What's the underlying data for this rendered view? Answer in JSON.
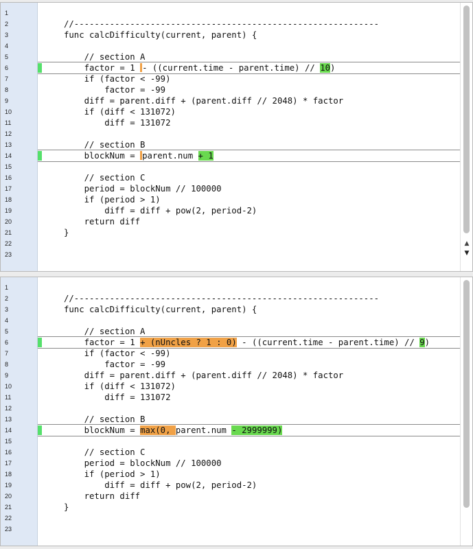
{
  "panes": [
    {
      "id": "before",
      "lines": [
        {
          "n": "1",
          "segs": []
        },
        {
          "n": "2",
          "segs": [
            {
              "t": "//------------------------------------------------------------"
            }
          ]
        },
        {
          "n": "3",
          "segs": [
            {
              "t": "func calcDifficulty(current, parent) {"
            }
          ]
        },
        {
          "n": "4",
          "segs": []
        },
        {
          "n": "5",
          "segs": [
            {
              "t": "    // section A"
            }
          ]
        },
        {
          "n": "6",
          "segs": [
            {
              "t": "    factor = 1 "
            },
            {
              "t": "",
              "h": "bar"
            },
            {
              "t": "- ((current.time - parent.time) // "
            },
            {
              "t": "10",
              "h": "green"
            },
            {
              "t": ")"
            }
          ],
          "marked": true
        },
        {
          "n": "7",
          "segs": [
            {
              "t": "    if (factor < -99)"
            }
          ]
        },
        {
          "n": "8",
          "segs": [
            {
              "t": "        factor = -99"
            }
          ]
        },
        {
          "n": "9",
          "segs": [
            {
              "t": "    diff = parent.diff + (parent.diff // 2048) * factor"
            }
          ]
        },
        {
          "n": "10",
          "segs": [
            {
              "t": "    if (diff < 131072)"
            }
          ]
        },
        {
          "n": "11",
          "segs": [
            {
              "t": "        diff = 131072"
            }
          ]
        },
        {
          "n": "12",
          "segs": []
        },
        {
          "n": "13",
          "segs": [
            {
              "t": "    // section B"
            }
          ]
        },
        {
          "n": "14",
          "segs": [
            {
              "t": "    blockNum = "
            },
            {
              "t": "",
              "h": "bar"
            },
            {
              "t": "parent.num "
            },
            {
              "t": "+ 1",
              "h": "green"
            }
          ],
          "marked": true
        },
        {
          "n": "15",
          "segs": []
        },
        {
          "n": "16",
          "segs": [
            {
              "t": "    // section C"
            }
          ]
        },
        {
          "n": "17",
          "segs": [
            {
              "t": "    period = blockNum // 100000"
            }
          ]
        },
        {
          "n": "18",
          "segs": [
            {
              "t": "    if (period > 1)"
            }
          ]
        },
        {
          "n": "19",
          "segs": [
            {
              "t": "        diff = diff + pow(2, period-2)"
            }
          ]
        },
        {
          "n": "20",
          "segs": [
            {
              "t": "    return diff"
            }
          ]
        },
        {
          "n": "21",
          "segs": [
            {
              "t": "}"
            }
          ]
        },
        {
          "n": "22",
          "segs": []
        },
        {
          "n": "23",
          "segs": []
        }
      ]
    },
    {
      "id": "after",
      "lines": [
        {
          "n": "1",
          "segs": []
        },
        {
          "n": "2",
          "segs": [
            {
              "t": "//------------------------------------------------------------"
            }
          ]
        },
        {
          "n": "3",
          "segs": [
            {
              "t": "func calcDifficulty(current, parent) {"
            }
          ]
        },
        {
          "n": "4",
          "segs": []
        },
        {
          "n": "5",
          "segs": [
            {
              "t": "    // section A"
            }
          ]
        },
        {
          "n": "6",
          "segs": [
            {
              "t": "    factor = 1 "
            },
            {
              "t": "+ (nUncles ? 1 : 0)",
              "h": "orange"
            },
            {
              "t": " - ((current.time - parent.time) // "
            },
            {
              "t": "9",
              "h": "green"
            },
            {
              "t": ")"
            }
          ],
          "marked": true
        },
        {
          "n": "7",
          "segs": [
            {
              "t": "    if (factor < -99)"
            }
          ]
        },
        {
          "n": "8",
          "segs": [
            {
              "t": "        factor = -99"
            }
          ]
        },
        {
          "n": "9",
          "segs": [
            {
              "t": "    diff = parent.diff + (parent.diff // 2048) * factor"
            }
          ]
        },
        {
          "n": "10",
          "segs": [
            {
              "t": "    if (diff < 131072)"
            }
          ]
        },
        {
          "n": "11",
          "segs": [
            {
              "t": "        diff = 131072"
            }
          ]
        },
        {
          "n": "12",
          "segs": []
        },
        {
          "n": "13",
          "segs": [
            {
              "t": "    // section B"
            }
          ]
        },
        {
          "n": "14",
          "segs": [
            {
              "t": "    blockNum = "
            },
            {
              "t": "max(0, ",
              "h": "orange"
            },
            {
              "t": "parent.num "
            },
            {
              "t": "- 2999999)",
              "h": "green"
            }
          ],
          "marked": true
        },
        {
          "n": "15",
          "segs": []
        },
        {
          "n": "16",
          "segs": [
            {
              "t": "    // section C"
            }
          ]
        },
        {
          "n": "17",
          "segs": [
            {
              "t": "    period = blockNum // 100000"
            }
          ]
        },
        {
          "n": "18",
          "segs": [
            {
              "t": "    if (period > 1)"
            }
          ]
        },
        {
          "n": "19",
          "segs": [
            {
              "t": "        diff = diff + pow(2, period-2)"
            }
          ]
        },
        {
          "n": "20",
          "segs": [
            {
              "t": "    return diff"
            }
          ]
        },
        {
          "n": "21",
          "segs": [
            {
              "t": "}"
            }
          ]
        },
        {
          "n": "22",
          "segs": []
        },
        {
          "n": "23",
          "segs": []
        }
      ]
    }
  ],
  "icons": {
    "scroll_up": "scroll-up-arrow-icon",
    "scroll_down": "scroll-down-arrow-icon"
  },
  "colors": {
    "changed_old": "#f0a146",
    "changed_new": "#69d94f",
    "gutter": "#dfe8f5"
  }
}
